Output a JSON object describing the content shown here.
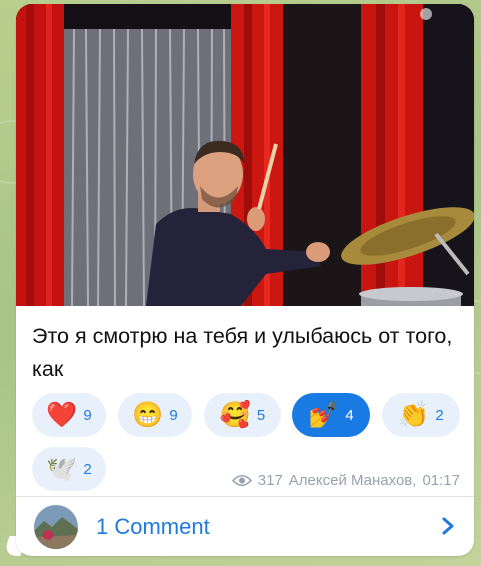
{
  "message": {
    "text": "Это я смотрю на тебя и улыбаюсь от того, как",
    "views": "317",
    "author": "Алексей Манахов",
    "time": "01:17"
  },
  "reactions": [
    {
      "emoji": "❤️",
      "icon": "red-heart-icon",
      "count": "9",
      "active": false
    },
    {
      "emoji": "😁",
      "icon": "grinning-face-icon",
      "count": "9",
      "active": false
    },
    {
      "emoji": "🥰",
      "icon": "smiling-face-with-hearts-icon",
      "count": "5",
      "active": false
    },
    {
      "emoji": "💅",
      "icon": "nail-polish-icon",
      "count": "4",
      "active": true
    },
    {
      "emoji": "👏",
      "icon": "clapping-hands-icon",
      "count": "2",
      "active": false
    },
    {
      "emoji": "🕊️",
      "icon": "dove-icon",
      "count": "2",
      "active": false
    }
  ],
  "comments": {
    "label": "1 Comment"
  },
  "colors": {
    "accent": "#1a7ae4",
    "pill_bg": "#e8f1fb",
    "meta": "#97a2ad"
  }
}
